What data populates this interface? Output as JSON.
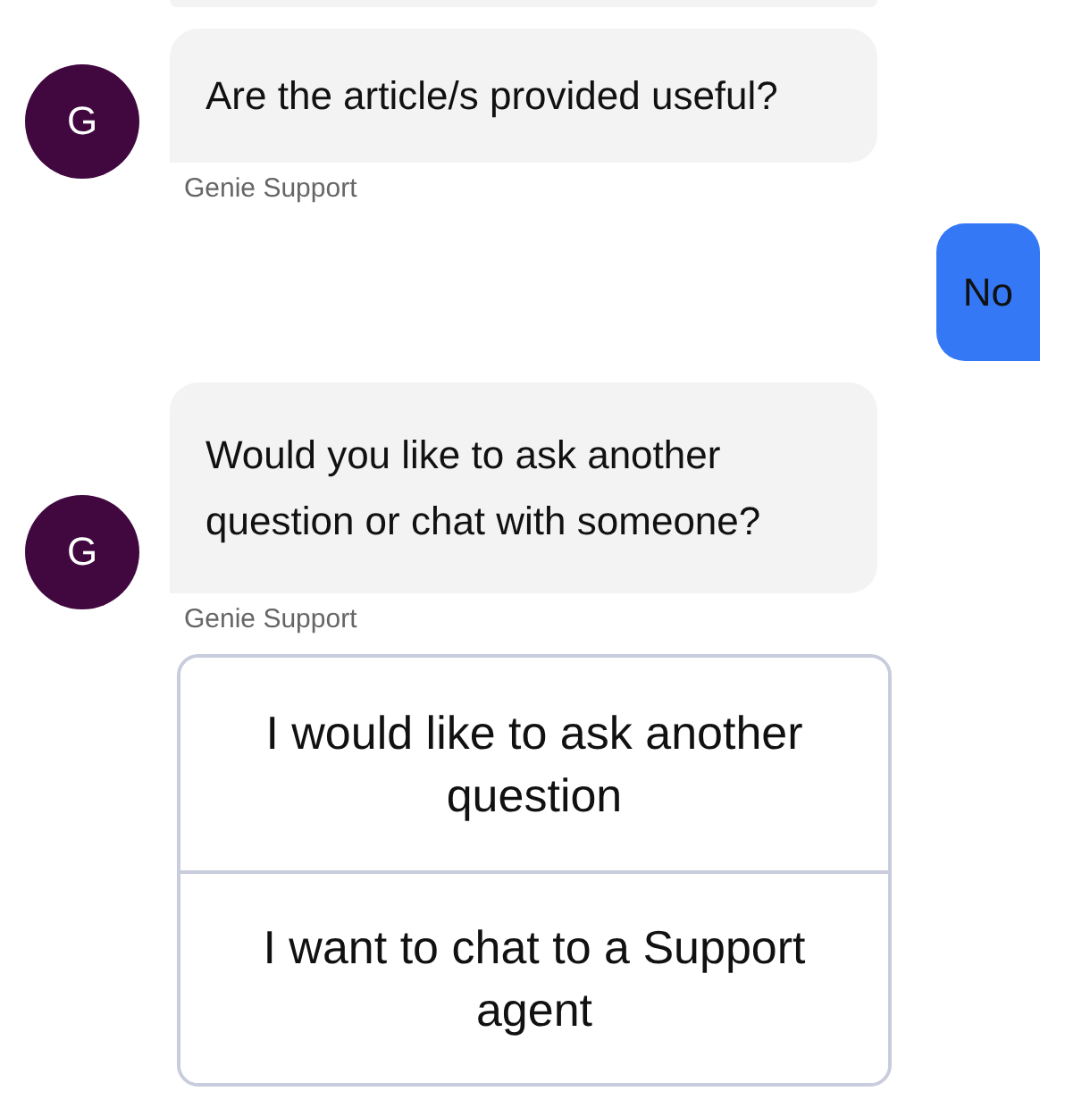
{
  "messages": [
    {
      "kind": "clipped"
    },
    {
      "kind": "bot",
      "avatar": "G",
      "text": "Are the article/s provided useful?",
      "sender": "Genie Support"
    },
    {
      "kind": "user",
      "text": "No"
    },
    {
      "kind": "bot",
      "avatar": "G",
      "text": "Would you like to ask another question or chat with someone?",
      "sender": "Genie Support"
    }
  ],
  "options": [
    "I would like to ask another question",
    "I want to chat to a Support agent"
  ]
}
